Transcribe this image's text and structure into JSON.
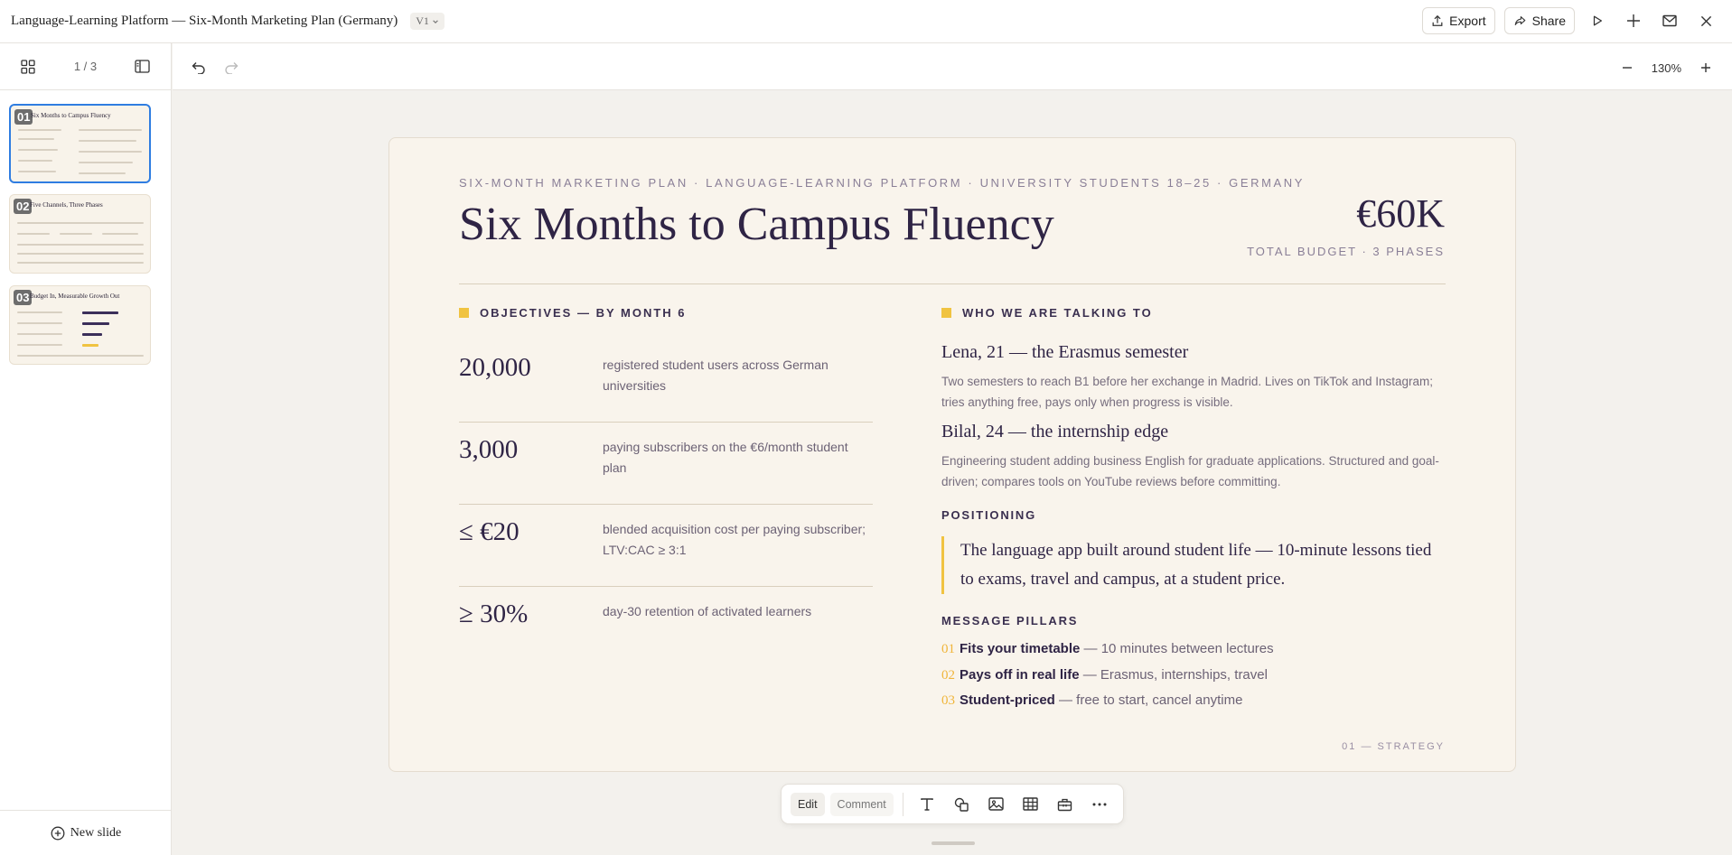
{
  "header": {
    "doc_title": "Language-Learning Platform — Six-Month Marketing Plan (Germany)",
    "version": "V1",
    "export_label": "Export",
    "share_label": "Share"
  },
  "sidebar": {
    "page_indicator": "1 / 3",
    "new_slide_label": "New slide",
    "thumbnails": [
      {
        "num": "01",
        "title": "Six Months to Campus Fluency"
      },
      {
        "num": "02",
        "title": "Five Channels, Three Phases"
      },
      {
        "num": "03",
        "title": "Budget In, Measurable Growth Out"
      }
    ]
  },
  "zoom": {
    "level": "130%"
  },
  "slide": {
    "kicker": "SIX-MONTH MARKETING PLAN · LANGUAGE-LEARNING PLATFORM · UNIVERSITY STUDENTS 18–25 · GERMANY",
    "title": "Six Months to Campus Fluency",
    "budget_value": "€60K",
    "budget_sub": "TOTAL BUDGET · 3 PHASES",
    "objectives_heading": "OBJECTIVES — BY MONTH 6",
    "objectives": [
      {
        "num": "20,000",
        "desc": "registered student users across German universities"
      },
      {
        "num": "3,000",
        "desc": "paying subscribers on the €6/month student plan"
      },
      {
        "num": "≤ €20",
        "desc": "blended acquisition cost per paying subscriber; LTV:CAC ≥ 3:1"
      },
      {
        "num": "≥ 30%",
        "desc": "day-30 retention of activated learners"
      }
    ],
    "audience_heading": "WHO WE ARE TALKING TO",
    "personas": [
      {
        "name": "Lena, 21 — the Erasmus semester",
        "desc": "Two semesters to reach B1 before her exchange in Madrid. Lives on TikTok and Instagram; tries anything free, pays only when progress is visible."
      },
      {
        "name": "Bilal, 24 — the internship edge",
        "desc": "Engineering student adding business English for graduate applications. Structured and goal-driven; compares tools on YouTube reviews before committing."
      }
    ],
    "positioning_heading": "POSITIONING",
    "positioning_quote": "The language app built around student life — 10-minute lessons tied to exams, travel and campus, at a student price.",
    "pillars_heading": "MESSAGE PILLARS",
    "pillars": [
      {
        "num": "01",
        "bold": "Fits your timetable",
        "rest": " — 10 minutes between lectures"
      },
      {
        "num": "02",
        "bold": "Pays off in real life",
        "rest": " — Erasmus, internships, travel"
      },
      {
        "num": "03",
        "bold": "Student-priced",
        "rest": " — free to start, cancel anytime"
      }
    ],
    "footer_tag": "01 — STRATEGY"
  },
  "toolbar": {
    "edit_label": "Edit",
    "comment_label": "Comment"
  },
  "colors": {
    "accent": "#f0c341",
    "ink": "#2f2445",
    "slide_bg": "#f9f4ec",
    "selection": "#2f7de1"
  }
}
